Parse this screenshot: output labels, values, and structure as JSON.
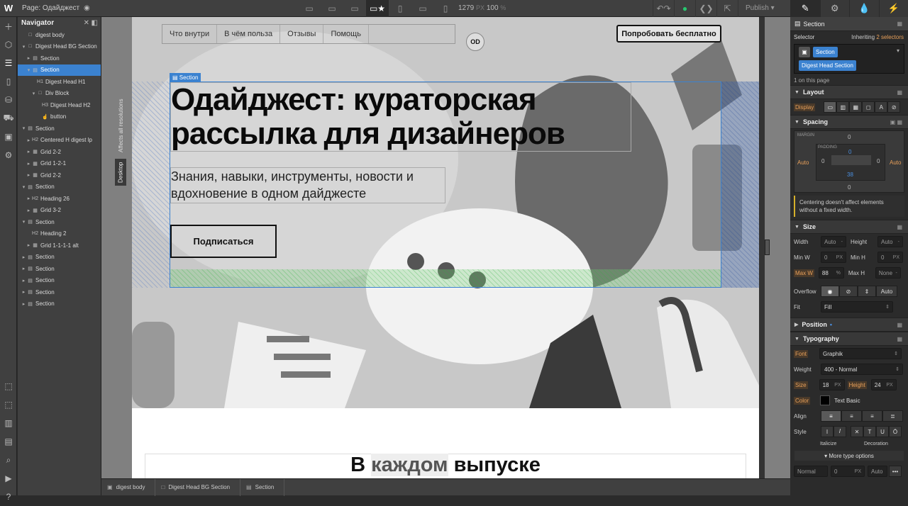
{
  "topbar": {
    "page_label": "Page: Одайджест",
    "zoom_width": "1279",
    "zoom_unit": "PX",
    "zoom_pct": "100",
    "zoom_pct_unit": "%",
    "publish": "Publish"
  },
  "navigator": {
    "title": "Navigator",
    "items": [
      {
        "label": "digest body",
        "indent": 0,
        "arrow": "",
        "icon": "□"
      },
      {
        "label": "Digest Head BG Section",
        "indent": 0,
        "arrow": "▾",
        "icon": "□"
      },
      {
        "label": "Section",
        "indent": 1,
        "arrow": "▸",
        "icon": "▤"
      },
      {
        "label": "Section",
        "indent": 1,
        "arrow": "▾",
        "icon": "▤",
        "selected": true
      },
      {
        "label": "Digest Head H1",
        "indent": 2,
        "arrow": "",
        "icon": "H1"
      },
      {
        "label": "Div Block",
        "indent": 2,
        "arrow": "▾",
        "icon": "□"
      },
      {
        "label": "Digest Head H2",
        "indent": 3,
        "arrow": "",
        "icon": "H3"
      },
      {
        "label": "button",
        "indent": 3,
        "arrow": "",
        "icon": "☝"
      },
      {
        "label": "Section",
        "indent": 0,
        "arrow": "▾",
        "icon": "▤"
      },
      {
        "label": "Centered H digest lp",
        "indent": 1,
        "arrow": "▸",
        "icon": "H2"
      },
      {
        "label": "Grid 2-2",
        "indent": 1,
        "arrow": "▸",
        "icon": "▦"
      },
      {
        "label": "Grid 1-2-1",
        "indent": 1,
        "arrow": "▸",
        "icon": "▦"
      },
      {
        "label": "Grid 2-2",
        "indent": 1,
        "arrow": "▸",
        "icon": "▦"
      },
      {
        "label": "Section",
        "indent": 0,
        "arrow": "▾",
        "icon": "▤"
      },
      {
        "label": "Heading 26",
        "indent": 1,
        "arrow": "▸",
        "icon": "H2"
      },
      {
        "label": "Grid 3-2",
        "indent": 1,
        "arrow": "▸",
        "icon": "▦"
      },
      {
        "label": "Section",
        "indent": 0,
        "arrow": "▾",
        "icon": "▤"
      },
      {
        "label": "Heading 2",
        "indent": 1,
        "arrow": "",
        "icon": "H2"
      },
      {
        "label": "Grid 1-1-1-1 alt",
        "indent": 1,
        "arrow": "▸",
        "icon": "▦"
      },
      {
        "label": "Section",
        "indent": 0,
        "arrow": "▸",
        "icon": "▤"
      },
      {
        "label": "Section",
        "indent": 0,
        "arrow": "▸",
        "icon": "▤"
      },
      {
        "label": "Section",
        "indent": 0,
        "arrow": "▸",
        "icon": "▤"
      },
      {
        "label": "Section",
        "indent": 0,
        "arrow": "▸",
        "icon": "▤"
      },
      {
        "label": "Section",
        "indent": 0,
        "arrow": "▸",
        "icon": "▤"
      }
    ]
  },
  "canvas": {
    "affects_label": "Affects all resolutions",
    "desktop_label": "Desktop",
    "selection_tag": "Section",
    "nav_links": [
      "Что внутри",
      "В чём польза",
      "Отзывы",
      "Помощь"
    ],
    "logo_text": "OD",
    "cta_button": "Попробовать бесплатно",
    "hero_title": "Одайджест: кураторская рассылка для дизайнеров",
    "hero_subtitle": "Знания, навыки, инструменты, новости и вдохновение в одном дайджесте",
    "subscribe_button": "Подписаться",
    "section2_heading_pre": "В ",
    "section2_heading_mid": "каждом",
    "section2_heading_post": " выпуске"
  },
  "breadcrumb": [
    "digest body",
    "Digest Head BG Section",
    "Section"
  ],
  "panel": {
    "element_name": "Section",
    "selector_label": "Selector",
    "inheriting_text": "Inheriting",
    "inheriting_count": "2 selectors",
    "selector_chip": "Section",
    "selector_chip2": "Digest Head Section",
    "on_page": "1 on this page",
    "layout_title": "Layout",
    "display_label": "Display",
    "spacing_title": "Spacing",
    "margin_label": "MARGIN",
    "padding_label": "PADDING",
    "margin_top": "0",
    "margin_bottom": "0",
    "margin_left": "Auto",
    "margin_right": "Auto",
    "padding_top": "0",
    "padding_bottom": "38",
    "padding_left": "0",
    "padding_right": "0",
    "centering_note": "Centering doesn't affect elements without a fixed width.",
    "size_title": "Size",
    "width_label": "Width",
    "width_val": "Auto",
    "height_label": "Height",
    "height_val": "Auto",
    "minw_label": "Min W",
    "minw_val": "0",
    "minh_label": "Min H",
    "minh_val": "0",
    "maxw_label": "Max W",
    "maxw_val": "88",
    "maxw_unit": "%",
    "maxh_label": "Max H",
    "maxh_val": "None",
    "unit_px": "PX",
    "overflow_label": "Overflow",
    "overflow_auto": "Auto",
    "fit_label": "Fit",
    "fit_val": "Fill",
    "position_title": "Position",
    "typography_title": "Typography",
    "font_label": "Font",
    "font_val": "Graphik",
    "weight_label": "Weight",
    "weight_val": "400 - Normal",
    "size_label": "Size",
    "size_val": "18",
    "height2_label": "Height",
    "height2_val": "24",
    "color_label": "Color",
    "color_val": "Text Basic",
    "align_label": "Align",
    "style_label": "Style",
    "italicize_label": "Italicize",
    "decoration_label": "Decoration",
    "more_options": "More type options",
    "bottom_normal": "Normal",
    "bottom_zero": "0",
    "bottom_auto": "Auto",
    "accent_color": "#3b82d0"
  }
}
